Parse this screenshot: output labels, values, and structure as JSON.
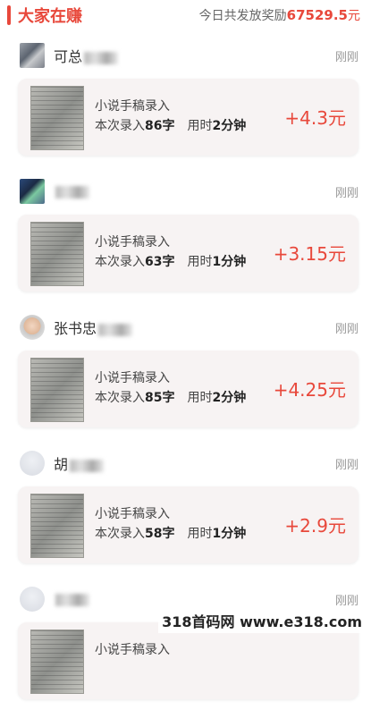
{
  "header": {
    "title": "大家在赚",
    "reward_label": "今日共发放奖励",
    "reward_amount": "67529.5",
    "reward_unit": "元"
  },
  "entries": [
    {
      "name": "可总",
      "time": "刚刚",
      "task": "小说手稿录入",
      "count_prefix": "本次录入",
      "count": "86字",
      "duration_prefix": "用时",
      "duration": "2分钟",
      "reward": "+4.3元",
      "avatar": "pix1"
    },
    {
      "name": "",
      "time": "刚刚",
      "task": "小说手稿录入",
      "count_prefix": "本次录入",
      "count": "63字",
      "duration_prefix": "用时",
      "duration": "1分钟",
      "reward": "+3.15元",
      "avatar": "pix2"
    },
    {
      "name": "张书忠",
      "time": "刚刚",
      "task": "小说手稿录入",
      "count_prefix": "本次录入",
      "count": "85字",
      "duration_prefix": "用时",
      "duration": "2分钟",
      "reward": "+4.25元",
      "avatar": "face"
    },
    {
      "name": "胡",
      "time": "刚刚",
      "task": "小说手稿录入",
      "count_prefix": "本次录入",
      "count": "58字",
      "duration_prefix": "用时",
      "duration": "1分钟",
      "reward": "+2.9元",
      "avatar": "blank"
    },
    {
      "name": "",
      "time": "刚刚",
      "task": "小说手稿录入",
      "count_prefix": "",
      "count": "",
      "duration_prefix": "",
      "duration": "",
      "reward": "",
      "avatar": "blank"
    }
  ],
  "watermark": "318首码网 www.e318.com"
}
